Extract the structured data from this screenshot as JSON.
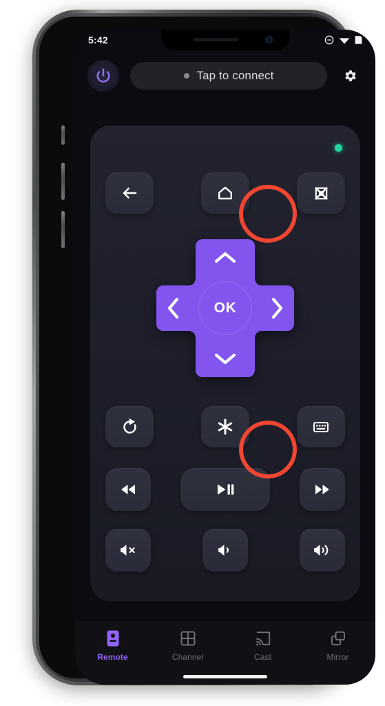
{
  "status_bar": {
    "time": "5:42",
    "icons": [
      "do-not-disturb-icon",
      "wifi-icon",
      "battery-icon"
    ]
  },
  "header": {
    "power_button": "power-icon",
    "connect_label": "Tap to connect",
    "connect_status": "disconnected",
    "settings_button": "gear-icon"
  },
  "remote": {
    "connection_indicator": "connected-led",
    "indicator_color": "#1fd6a0",
    "accent_color": "#8355ee",
    "annotation_color": "#f04632",
    "nav_row": [
      {
        "name": "back-button",
        "icon": "arrow-left-icon",
        "label": "Back"
      },
      {
        "name": "home-button",
        "icon": "home-icon",
        "label": "Home",
        "annotated": true
      },
      {
        "name": "fullscreen-button",
        "icon": "fullscreen-icon",
        "label": "Fullscreen"
      }
    ],
    "dpad": {
      "up": "chevron-up-icon",
      "down": "chevron-down-icon",
      "left": "chevron-left-icon",
      "right": "chevron-right-icon",
      "ok_label": "OK"
    },
    "function_row": [
      {
        "name": "replay-button",
        "icon": "replay-icon",
        "label": "Replay"
      },
      {
        "name": "options-button",
        "icon": "asterisk-icon",
        "label": "Options",
        "annotated": true
      },
      {
        "name": "keyboard-button",
        "icon": "keyboard-icon",
        "label": "Keyboard"
      }
    ],
    "playback_row": [
      {
        "name": "rewind-button",
        "icon": "rewind-icon",
        "label": "Rewind"
      },
      {
        "name": "play-pause-button",
        "icon": "play-pause-icon",
        "label": "Play / Pause"
      },
      {
        "name": "fast-forward-button",
        "icon": "fast-forward-icon",
        "label": "Fast forward"
      }
    ],
    "volume_row": [
      {
        "name": "mute-button",
        "icon": "volume-mute-icon",
        "label": "Mute"
      },
      {
        "name": "volume-down-button",
        "icon": "volume-down-icon",
        "label": "Volume down"
      },
      {
        "name": "volume-up-button",
        "icon": "volume-up-icon",
        "label": "Volume up"
      }
    ]
  },
  "bottom_nav": {
    "active_index": 0,
    "items": [
      {
        "label": "Remote",
        "icon": "remote-icon"
      },
      {
        "label": "Channel",
        "icon": "grid-icon"
      },
      {
        "label": "Cast",
        "icon": "cast-icon"
      },
      {
        "label": "Mirror",
        "icon": "screen-mirror-icon"
      }
    ]
  }
}
